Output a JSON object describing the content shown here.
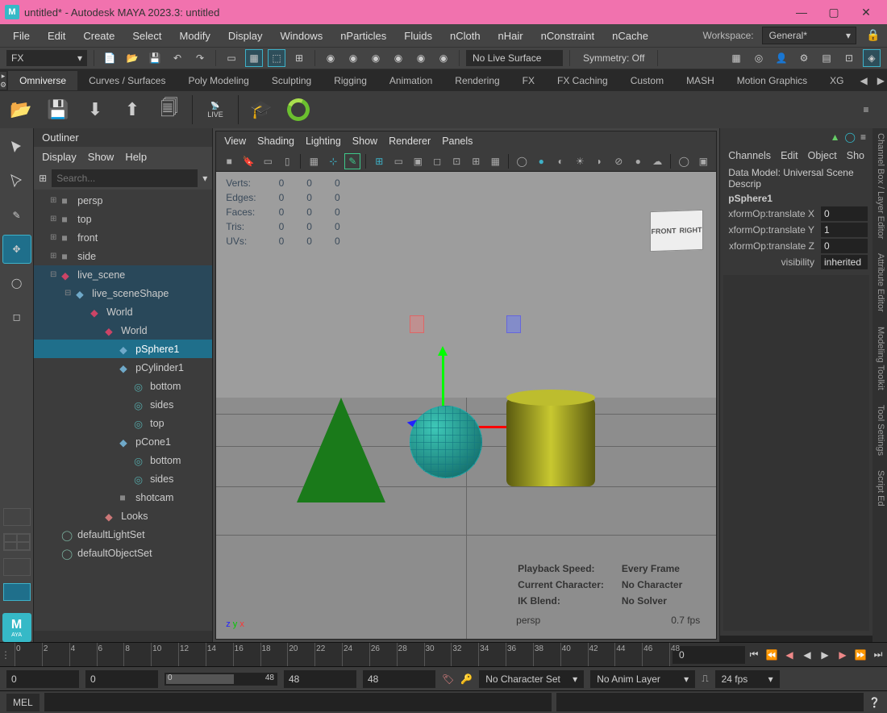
{
  "window": {
    "title": "untitled* - Autodesk MAYA 2023.3: untitled",
    "logo_letter": "M"
  },
  "menu": [
    "File",
    "Edit",
    "Create",
    "Select",
    "Modify",
    "Display",
    "Windows",
    "nParticles",
    "Fluids",
    "nCloth",
    "nHair",
    "nConstraint",
    "nCache"
  ],
  "workspace": {
    "label": "Workspace:",
    "value": "General*"
  },
  "shelf": {
    "mode": "FX",
    "live_surface": "No Live Surface",
    "symmetry": "Symmetry: Off",
    "tabs": [
      "Omniverse",
      "Curves / Surfaces",
      "Poly Modeling",
      "Sculpting",
      "Rigging",
      "Animation",
      "Rendering",
      "FX",
      "FX Caching",
      "Custom",
      "MASH",
      "Motion Graphics",
      "XG"
    ],
    "active_tab": 0,
    "live_label": "LIVE"
  },
  "outliner": {
    "title": "Outliner",
    "subtabs": [
      "Display",
      "Show",
      "Help"
    ],
    "search_placeholder": "Search...",
    "cameras": [
      "persp",
      "top",
      "front",
      "side"
    ],
    "scene_root": "live_scene",
    "scene_shape": "live_sceneShape",
    "world1": "World",
    "world2": "World",
    "pSphere": "pSphere1",
    "pCylinder": "pCylinder1",
    "cyl_children": [
      "bottom",
      "sides",
      "top"
    ],
    "pCone": "pCone1",
    "cone_children": [
      "bottom",
      "sides"
    ],
    "shotcam": "shotcam",
    "looks": "Looks",
    "sets": [
      "defaultLightSet",
      "defaultObjectSet"
    ]
  },
  "viewport": {
    "menus": [
      "View",
      "Shading",
      "Lighting",
      "Show",
      "Renderer",
      "Panels"
    ],
    "hud_rows": [
      {
        "label": "Verts:",
        "a": "0",
        "b": "0",
        "c": "0"
      },
      {
        "label": "Edges:",
        "a": "0",
        "b": "0",
        "c": "0"
      },
      {
        "label": "Faces:",
        "a": "0",
        "b": "0",
        "c": "0"
      },
      {
        "label": "Tris:",
        "a": "0",
        "b": "0",
        "c": "0"
      },
      {
        "label": "UVs:",
        "a": "0",
        "b": "0",
        "c": "0"
      }
    ],
    "camcube": {
      "front": "FRONT",
      "right": "RIGHT"
    },
    "hud2": [
      {
        "l": "Playback Speed:",
        "v": "Every Frame"
      },
      {
        "l": "Current Character:",
        "v": "No Character"
      },
      {
        "l": "IK Blend:",
        "v": "No Solver"
      }
    ],
    "camera": "persp",
    "fps": "0.7 fps",
    "axes": {
      "x": "x",
      "y": "y",
      "z": "z"
    }
  },
  "channels": {
    "tabs": [
      "Channels",
      "Edit",
      "Object",
      "Sho"
    ],
    "data_model": "Data Model: Universal Scene Descrip",
    "node": "pSphere1",
    "attrs": [
      {
        "label": "xformOp:translate X",
        "value": "0"
      },
      {
        "label": "xformOp:translate Y",
        "value": "1"
      },
      {
        "label": "xformOp:translate Z",
        "value": "0"
      },
      {
        "label": "visibility",
        "value": "inherited"
      }
    ]
  },
  "right_tabs": [
    "Channel Box / Layer Editor",
    "Attribute Editor",
    "Modeling Toolkit",
    "Tool Settings",
    "Script Ed"
  ],
  "timeline": {
    "ticks": [
      0,
      2,
      4,
      6,
      8,
      10,
      12,
      14,
      16,
      18,
      20,
      22,
      24,
      26,
      28,
      30,
      32,
      34,
      36,
      38,
      40,
      42,
      44,
      46,
      48
    ],
    "current": "0"
  },
  "range": {
    "start_out": "0",
    "start_in": "0",
    "slider_start": "0",
    "slider_end": "48",
    "end_in": "48",
    "end_out": "48",
    "charset": "No Character Set",
    "animlayer": "No Anim Layer",
    "fps": "24 fps"
  },
  "cmd": {
    "lang": "MEL"
  }
}
